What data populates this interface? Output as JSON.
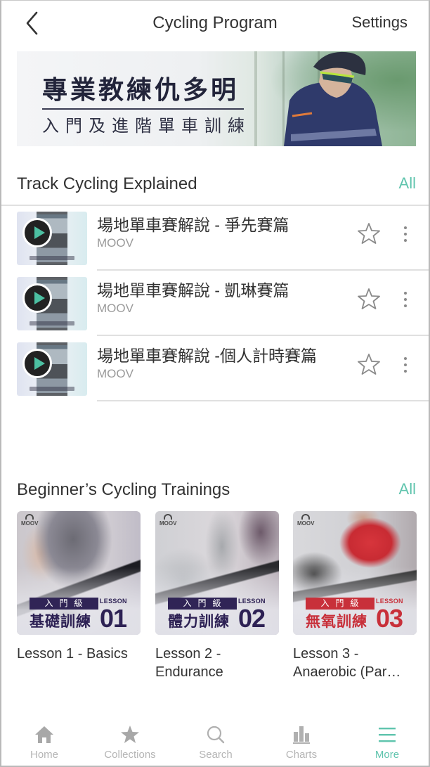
{
  "navbar": {
    "back_icon": "chevron-left-icon",
    "title": "Cycling Program",
    "settings_label": "Settings"
  },
  "banner": {
    "title": "專業教練仇多明",
    "subtitle": "入門及進階單車訓練"
  },
  "track_section": {
    "title": "Track Cycling Explained",
    "all_label": "All",
    "items": [
      {
        "title": "場地單車賽解說 - 爭先賽篇",
        "artist": "MOOV",
        "favorited": false
      },
      {
        "title": "場地單車賽解說 - 凱琳賽篇",
        "artist": "MOOV",
        "favorited": false
      },
      {
        "title": "場地單車賽解說 -個人計時賽篇",
        "artist": "MOOV",
        "favorited": false
      }
    ]
  },
  "training_section": {
    "title": "Beginner’s Cycling Trainings",
    "all_label": "All",
    "cards": [
      {
        "caption": "Lesson 1 - Basics",
        "logo": "MOOV",
        "level": "入門級",
        "lesson_word": "LESSON",
        "lesson_cn": "基礎訓練",
        "lesson_num": "01",
        "theme_color": "#2d2154"
      },
      {
        "caption": "Lesson 2 - Endurance",
        "logo": "MOOV",
        "level": "入門級",
        "lesson_word": "LESSON",
        "lesson_cn": "體力訓練",
        "lesson_num": "02",
        "theme_color": "#2d2154"
      },
      {
        "caption": "Lesson 3 - Anaerobic (Par…",
        "logo": "MOOV",
        "level": "入門級",
        "lesson_word": "LESSON",
        "lesson_cn": "無氧訓練",
        "lesson_num": "03",
        "theme_color": "#c8303a"
      }
    ]
  },
  "tabbar": {
    "tabs": [
      {
        "label": "Home",
        "icon": "home-icon",
        "active": false
      },
      {
        "label": "Collections",
        "icon": "star-icon",
        "active": false
      },
      {
        "label": "Search",
        "icon": "search-icon",
        "active": false
      },
      {
        "label": "Charts",
        "icon": "bar-chart-icon",
        "active": false
      },
      {
        "label": "More",
        "icon": "menu-icon",
        "active": true
      }
    ]
  },
  "colors": {
    "accent": "#5fc4ad",
    "text_primary": "#333333",
    "text_secondary": "#9a9a9a",
    "tab_inactive": "#b5b5b5",
    "divider": "#e0e0e0"
  }
}
